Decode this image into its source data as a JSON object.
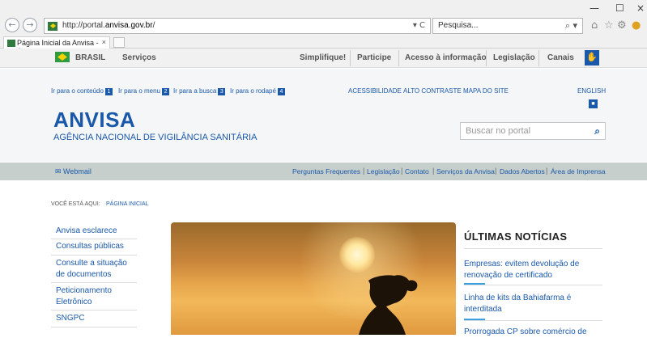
{
  "browser": {
    "url_prefix": "http://portal.",
    "url_domain": "anvisa.gov.br",
    "url_suffix": "/",
    "address_controls": "▾ C",
    "search_placeholder": "Pesquisa...",
    "search_controls": "⌕ ▾",
    "tab_title": "Página Inicial da Anvisa - A...",
    "tab_close": "×",
    "back": "←",
    "forward": "→",
    "minimize": "—",
    "maximize": "☐",
    "close": "×"
  },
  "govbar": {
    "brasil": "BRASIL",
    "servicos": "Serviços",
    "items": [
      "Simplifique!",
      "Participe",
      "Acesso à informação",
      "Legislação",
      "Canais"
    ]
  },
  "accessibility": {
    "skip": [
      {
        "label": "Ir para o conteúdo",
        "key": "1"
      },
      {
        "label": "Ir para o menu",
        "key": "2"
      },
      {
        "label": "Ir para a busca",
        "key": "3"
      },
      {
        "label": "Ir para o rodapé",
        "key": "4"
      }
    ],
    "acessibilidade": "ACESSIBILIDADE",
    "alto_contraste": "ALTO CONTRASTE",
    "mapa_site": "MAPA DO SITE",
    "english": "ENGLISH"
  },
  "header": {
    "brand": "ANVISA",
    "subtitle": "AGÊNCIA NACIONAL DE VIGILÂNCIA SANITÁRIA",
    "search_placeholder": "Buscar no portal"
  },
  "servbar": {
    "webmail": "Webmail",
    "links": [
      "Perguntas Frequentes",
      "Legislação",
      "Contato",
      "Serviços da Anvisa",
      "Dados Abertos",
      "Área de Imprensa"
    ],
    "separator": "|"
  },
  "breadcrumb": {
    "label": "VOCÊ ESTÁ AQUI:",
    "current": "PÁGINA INICIAL"
  },
  "menu": [
    "Anvisa esclarece",
    "Consultas públicas",
    "Consulte a situação de documentos",
    "Peticionamento Eletrônico",
    "SNGPC"
  ],
  "news": {
    "heading": "ÚLTIMAS NOTÍCIAS",
    "items": [
      "Empresas: evitem devolução de renovação de certificado",
      "Linha de kits da Bahiafarma é interditada",
      "Prorrogada CP sobre comércio de"
    ]
  }
}
